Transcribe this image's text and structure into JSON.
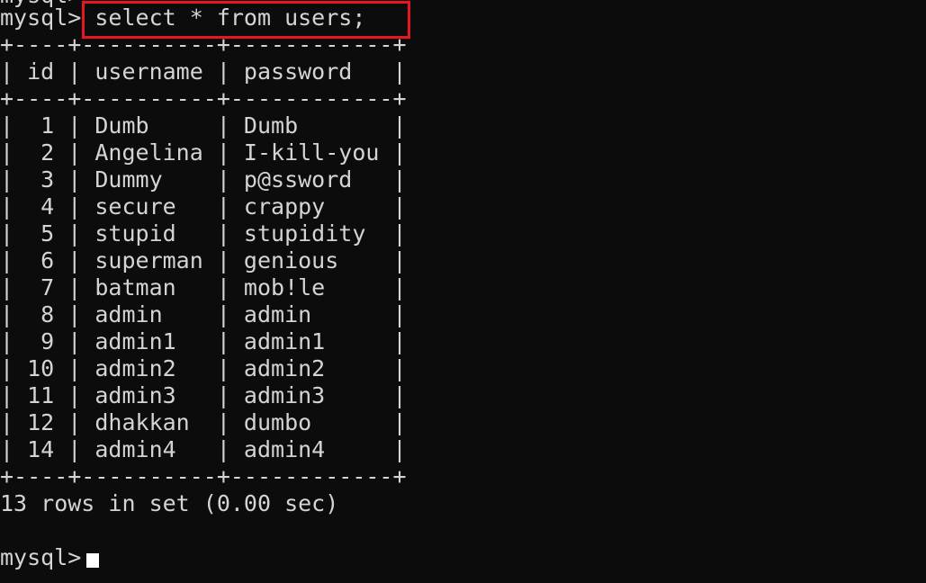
{
  "terminal": {
    "prev_fragment": "mysql>",
    "prompt": "mysql>",
    "command": " select * from users;",
    "border": "+----+----------+------------+",
    "header": "| id | username | password   |",
    "rows": [
      "|  1 | Dumb     | Dumb       |",
      "|  2 | Angelina | I-kill-you |",
      "|  3 | Dummy    | p@ssword   |",
      "|  4 | secure   | crappy     |",
      "|  5 | stupid   | stupidity  |",
      "|  6 | superman | genious    |",
      "|  7 | batman   | mob!le     |",
      "|  8 | admin    | admin      |",
      "|  9 | admin1   | admin1     |",
      "| 10 | admin2   | admin2     |",
      "| 11 | admin3   | admin3     |",
      "| 12 | dhakkan  | dumbo      |",
      "| 14 | admin4   | admin4     |"
    ],
    "result_info": "13 rows in set (0.00 sec)",
    "prompt2": "mysql>",
    "highlight_color": "#e8171f",
    "background": "#0c0c0c",
    "text_color": "#d4d4d4"
  }
}
